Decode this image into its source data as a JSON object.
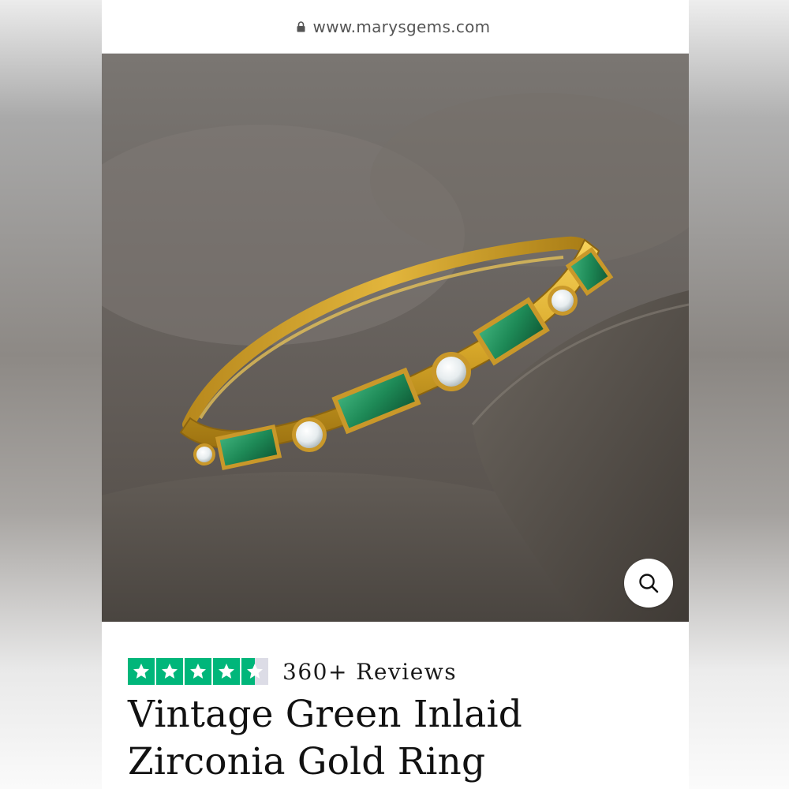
{
  "browser": {
    "url": "www.marysgems.com",
    "lock_icon": "lock-icon"
  },
  "hero": {
    "image_alt": "Gold ring with green baguette stones and round white zirconia",
    "zoom_icon": "magnifier-icon"
  },
  "rating": {
    "stars_filled": 4.5,
    "stars_total": 5,
    "star_color": "#00b67a",
    "reviews_label": "360+ Reviews"
  },
  "product": {
    "title": "Vintage Green Inlaid Zirconia Gold Ring"
  }
}
